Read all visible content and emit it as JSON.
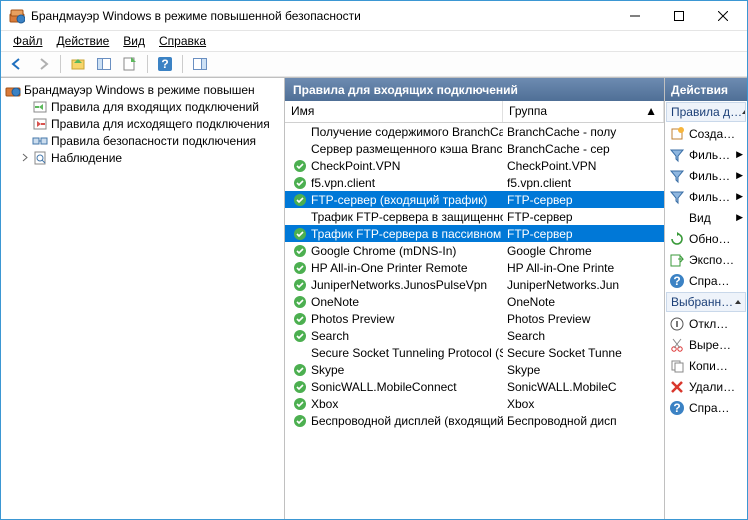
{
  "window": {
    "title": "Брандмауэр Windows в режиме повышенной безопасности"
  },
  "menu": {
    "file": "Файл",
    "action": "Действие",
    "view": "Вид",
    "help": "Справка"
  },
  "tree": {
    "root": "Брандмауэр Windows в режиме повышен",
    "items": [
      "Правила для входящих подключений",
      "Правила для исходящего подключения",
      "Правила безопасности подключения",
      "Наблюдение"
    ]
  },
  "center": {
    "title": "Правила для входящих подключений",
    "cols": {
      "name": "Имя",
      "group": "Группа"
    },
    "rows": [
      {
        "name": "Получение содержимого BranchCache …",
        "group": "BranchCache - полу",
        "enabled": false,
        "sel": false
      },
      {
        "name": "Сервер размещенного кэша BranchCa…",
        "group": "BranchCache - сер",
        "enabled": false,
        "sel": false
      },
      {
        "name": "CheckPoint.VPN",
        "group": "CheckPoint.VPN",
        "enabled": true,
        "sel": false
      },
      {
        "name": "f5.vpn.client",
        "group": "f5.vpn.client",
        "enabled": true,
        "sel": false
      },
      {
        "name": "FTP-сервер (входящий трафик)",
        "group": "FTP-сервер",
        "enabled": true,
        "sel": true
      },
      {
        "name": "Трафик FTP-сервера в защищенном р…",
        "group": "FTP-сервер",
        "enabled": false,
        "sel": false
      },
      {
        "name": "Трафик FTP-сервера в пассивном реж…",
        "group": "FTP-сервер",
        "enabled": true,
        "sel": true
      },
      {
        "name": "Google Chrome (mDNS-In)",
        "group": "Google Chrome",
        "enabled": true,
        "sel": false
      },
      {
        "name": "HP All-in-One Printer Remote",
        "group": "HP All-in-One Printe",
        "enabled": true,
        "sel": false
      },
      {
        "name": "JuniperNetworks.JunosPulseVpn",
        "group": "JuniperNetworks.Jun",
        "enabled": true,
        "sel": false
      },
      {
        "name": "OneNote",
        "group": "OneNote",
        "enabled": true,
        "sel": false
      },
      {
        "name": "Photos Preview",
        "group": "Photos Preview",
        "enabled": true,
        "sel": false
      },
      {
        "name": "Search",
        "group": "Search",
        "enabled": true,
        "sel": false
      },
      {
        "name": "Secure Socket Tunneling Protocol (SSTP-…",
        "group": "Secure Socket Tunne",
        "enabled": false,
        "sel": false
      },
      {
        "name": "Skype",
        "group": "Skype",
        "enabled": true,
        "sel": false
      },
      {
        "name": "SonicWALL.MobileConnect",
        "group": "SonicWALL.MobileC",
        "enabled": true,
        "sel": false
      },
      {
        "name": "Xbox",
        "group": "Xbox",
        "enabled": true,
        "sel": false
      },
      {
        "name": "Беспроводной дисплей (входящий тра…",
        "group": "Беспроводной дисп",
        "enabled": true,
        "sel": false
      }
    ]
  },
  "actions": {
    "title": "Действия",
    "group1": "Правила д…",
    "items1": [
      {
        "icon": "new",
        "label": "Созда…"
      },
      {
        "icon": "filter",
        "label": "Филь…"
      },
      {
        "icon": "filter",
        "label": "Филь…"
      },
      {
        "icon": "filter",
        "label": "Филь…"
      },
      {
        "icon": "view",
        "label": "Вид"
      },
      {
        "icon": "refresh",
        "label": "Обно…"
      },
      {
        "icon": "export",
        "label": "Экспо…"
      },
      {
        "icon": "help",
        "label": "Спра…"
      }
    ],
    "group2": "Выбранн…",
    "items2": [
      {
        "icon": "disable",
        "label": "Откл…"
      },
      {
        "icon": "cut",
        "label": "Выре…"
      },
      {
        "icon": "copy",
        "label": "Копи…"
      },
      {
        "icon": "delete",
        "label": "Удали…"
      },
      {
        "icon": "help",
        "label": "Спра…"
      }
    ]
  }
}
